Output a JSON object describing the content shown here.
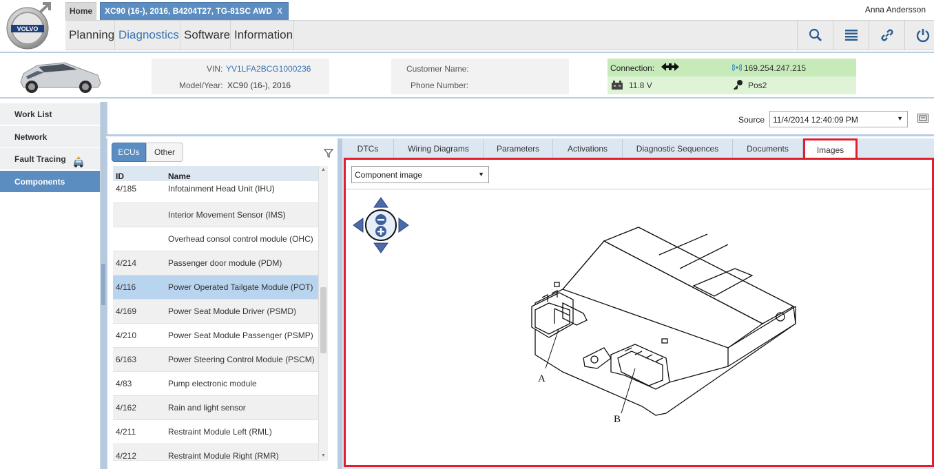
{
  "header": {
    "home_tab": "Home",
    "vehicle_tab": "XC90 (16-), 2016, B4204T27, TG-81SC AWD",
    "vehicle_tab_close": "X",
    "user_name": "Anna Andersson",
    "logo_text": "VOLVO",
    "menu": [
      "Planning",
      "Diagnostics",
      "Software",
      "Information"
    ],
    "active_menu": "Diagnostics",
    "tools": [
      "search-icon",
      "list-icon",
      "link-icon",
      "power-icon"
    ]
  },
  "vehicle": {
    "vin_label": "VIN:",
    "vin": "YV1LFA2BCG1000236",
    "model_label": "Model/Year:",
    "model": "XC90 (16-), 2016",
    "customer_label": "Customer Name:",
    "phone_label": "Phone Number:",
    "connection_label": "Connection:",
    "ip": "169.254.247.215",
    "voltage": "11.8 V",
    "key_position": "Pos2"
  },
  "leftnav": {
    "items": [
      "Work List",
      "Network",
      "Fault Tracing",
      "Components"
    ],
    "active": "Components"
  },
  "source": {
    "label": "Source",
    "value": "11/4/2014 12:40:09 PM"
  },
  "ecu_panel": {
    "segments": [
      "ECUs",
      "Other"
    ],
    "columns": [
      "ID",
      "Name"
    ],
    "rows": [
      {
        "id": "4/185",
        "name": "Infotainment Head Unit (IHU)"
      },
      {
        "id": "",
        "name": "Interior Movement Sensor (IMS)"
      },
      {
        "id": "",
        "name": "Overhead consol control module (OHC)"
      },
      {
        "id": "4/214",
        "name": "Passenger door module (PDM)"
      },
      {
        "id": "4/116",
        "name": "Power Operated Tailgate Module (POT)"
      },
      {
        "id": "4/169",
        "name": "Power Seat Module Driver (PSMD)"
      },
      {
        "id": "4/210",
        "name": "Power Seat Module Passenger (PSMP)"
      },
      {
        "id": "6/163",
        "name": "Power Steering Control Module (PSCM)"
      },
      {
        "id": "4/83",
        "name": "Pump electronic module"
      },
      {
        "id": "4/162",
        "name": "Rain and light sensor"
      },
      {
        "id": "4/211",
        "name": "Restraint Module Left (RML)"
      },
      {
        "id": "4/212",
        "name": "Restraint Module Right (RMR)"
      }
    ],
    "selected_index": 4
  },
  "right_panel": {
    "tabs": [
      "DTCs",
      "Wiring Diagrams",
      "Parameters",
      "Activations",
      "Diagnostic Sequences",
      "Documents",
      "Images"
    ],
    "active_tab": "Images",
    "image_select": "Component image",
    "callouts": [
      "A",
      "B"
    ]
  },
  "colors": {
    "accent": "#5b8dc1",
    "highlight": "#e01e2e",
    "connection_bg": "#c6ebb9"
  }
}
